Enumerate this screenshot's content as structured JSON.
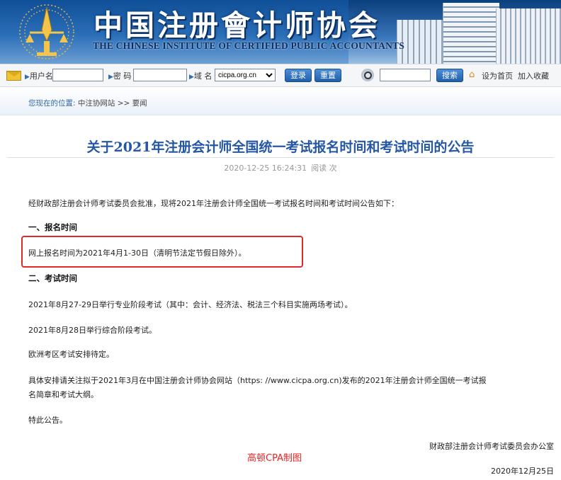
{
  "header": {
    "title_cn": "中国注册會计师协会",
    "title_en": "THE CHINESE INSTITUTE OF CERTIFIED PUBLIC ACCOUNTANTS"
  },
  "loginbar": {
    "username_label": "用户名",
    "password_label": "密 码",
    "domain_label": "域 名",
    "domain_value": "cicpa.org.cn",
    "login_button": "登录",
    "reset_button": "重置",
    "search_button": "搜索",
    "set_home": "设为首页",
    "add_favorite": "加入收藏"
  },
  "breadcrumb": {
    "label": "您现在的位置:",
    "path": "中注协网站 >> 要闻"
  },
  "article": {
    "title": "关于2021年注册会计师全国统一考试报名时间和考试时间的公告",
    "timestamp": "2020-12-25 16:24:31",
    "read_count": "阅读 次",
    "intro": "经财政部注册会计师考试委员会批准，现将2021年注册会计师全国统一考试报名时间和考试时间公告如下：",
    "section1_heading": "一、报名时间",
    "section1_text": "网上报名时间为2021年4月1-30日（清明节法定节假日除外）。",
    "section2_heading": "二、考试时间",
    "section2_line1": "2021年8月27-29日举行专业阶段考试（其中：会计、经济法、税法三个科目实施两场考试）。",
    "section2_line2": "2021年8月28日举行综合阶段考试。",
    "section2_line3": "欧洲考区考试安排待定。",
    "para_arrange_1": "具体安排请关注拟于2021年3月在中国注册会计师协会网站（https: //www.cicpa.org.cn)发布的2021年注册会计师全国统一考试报",
    "para_arrange_2": "名简章和考试大纲。",
    "closing": "特此公告。",
    "signature": "财政部注册会计师考试委员会办公室",
    "watermark": "高顿CPA制图",
    "date": "2020年12月25日"
  },
  "colors": {
    "title_blue": "#2457a6",
    "highlight_red": "#e02a2a",
    "button_blue": "#1f5fa8"
  }
}
